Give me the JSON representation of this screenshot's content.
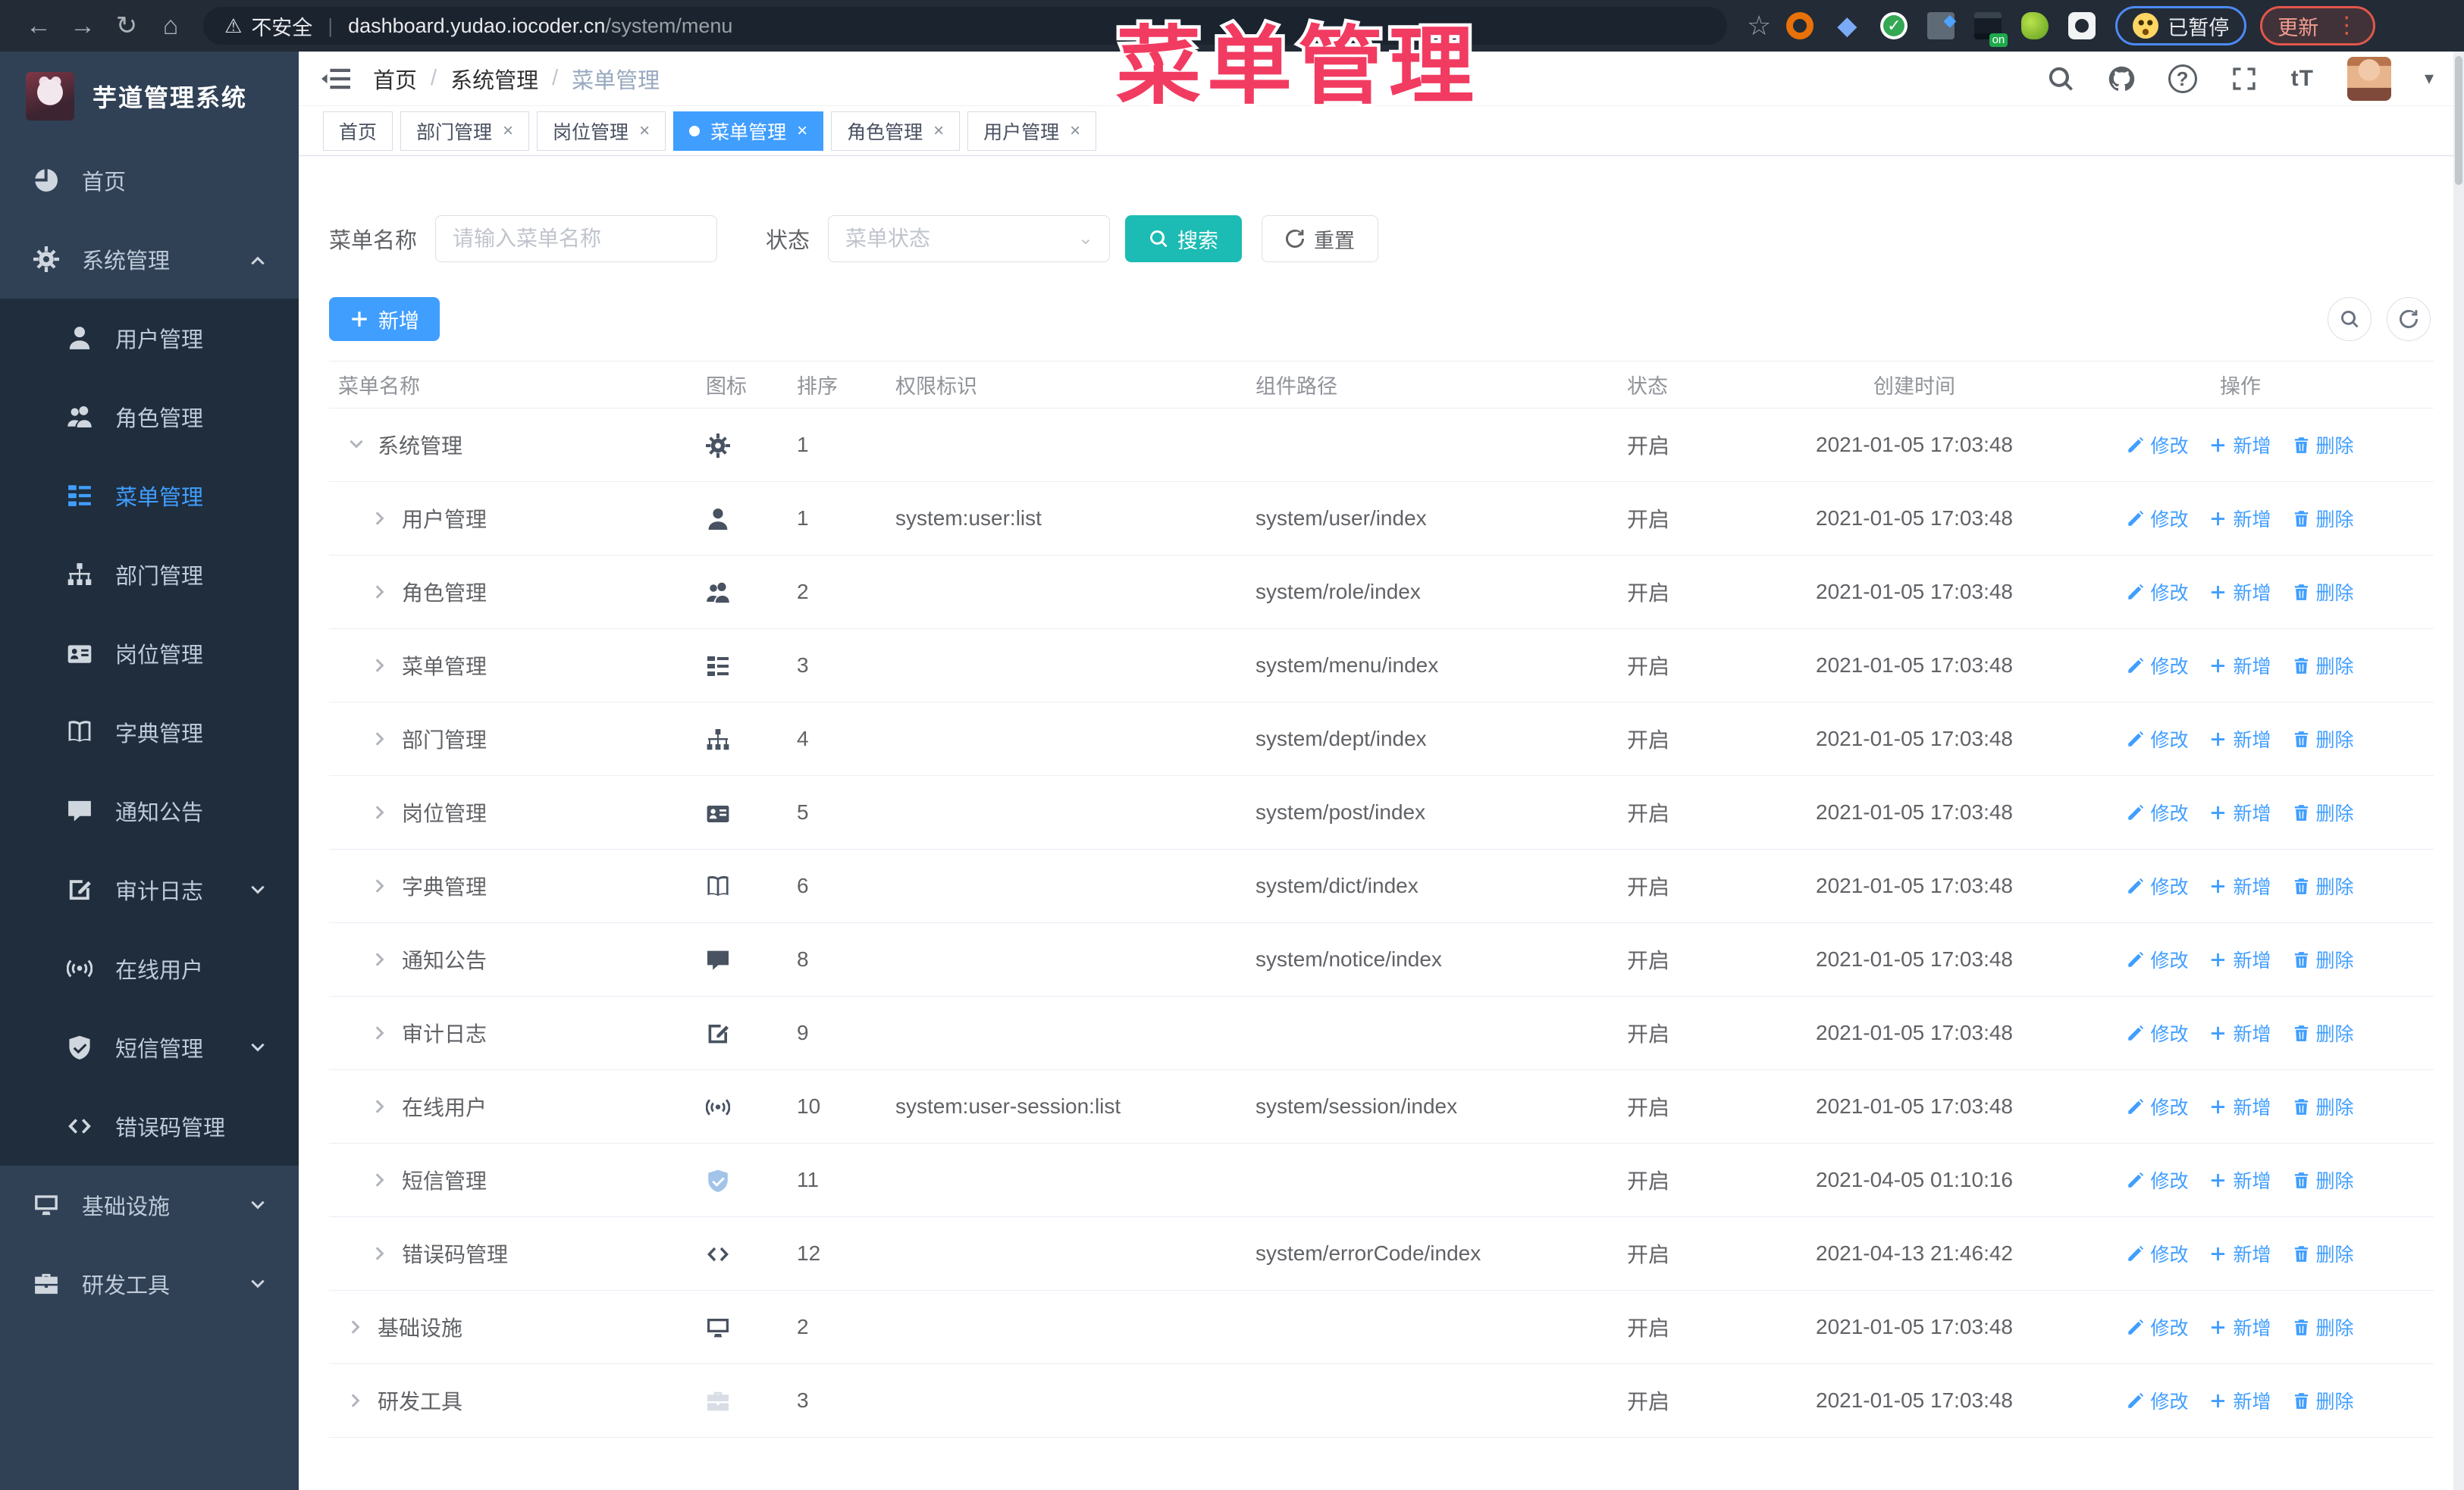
{
  "browser": {
    "security_label": "不安全",
    "url_domain": "dashboard.yudao.iocoder.cn",
    "url_path": "/system/menu",
    "paused_badge": "已暂停",
    "update_button": "更新",
    "toolbar_icons": [
      "back",
      "forward",
      "reload",
      "home",
      "warning",
      "star",
      "extensions",
      "profile",
      "menu-dots"
    ]
  },
  "overlay_title": "菜单管理",
  "sidebar": {
    "logo_title": "芋道管理系统",
    "items": [
      {
        "label": "首页",
        "icon": "dashboard",
        "type": "top",
        "chevron": ""
      },
      {
        "label": "系统管理",
        "icon": "gear",
        "type": "top",
        "chevron": "up"
      },
      {
        "label": "用户管理",
        "icon": "user",
        "type": "sub",
        "chevron": ""
      },
      {
        "label": "角色管理",
        "icon": "users",
        "type": "sub",
        "chevron": ""
      },
      {
        "label": "菜单管理",
        "icon": "tree-table",
        "type": "sub",
        "chevron": "",
        "active": true
      },
      {
        "label": "部门管理",
        "icon": "tree",
        "type": "sub",
        "chevron": ""
      },
      {
        "label": "岗位管理",
        "icon": "post",
        "type": "sub",
        "chevron": ""
      },
      {
        "label": "字典管理",
        "icon": "dict",
        "type": "sub",
        "chevron": ""
      },
      {
        "label": "通知公告",
        "icon": "message",
        "type": "sub",
        "chevron": ""
      },
      {
        "label": "审计日志",
        "icon": "log",
        "type": "sub",
        "chevron": "down"
      },
      {
        "label": "在线用户",
        "icon": "online",
        "type": "sub",
        "chevron": ""
      },
      {
        "label": "短信管理",
        "icon": "sms",
        "type": "sub",
        "chevron": "down"
      },
      {
        "label": "错误码管理",
        "icon": "code",
        "type": "sub",
        "chevron": ""
      },
      {
        "label": "基础设施",
        "icon": "monitor",
        "type": "top",
        "chevron": "down"
      },
      {
        "label": "研发工具",
        "icon": "tool",
        "type": "top",
        "chevron": "down"
      }
    ]
  },
  "breadcrumb": {
    "items": [
      "首页",
      "系统管理",
      "菜单管理"
    ]
  },
  "header_icons": [
    "search",
    "github",
    "help",
    "fullscreen",
    "font-size",
    "avatar",
    "caret-down"
  ],
  "tabs": [
    {
      "label": "首页",
      "closable": false,
      "active": false
    },
    {
      "label": "部门管理",
      "closable": true,
      "active": false
    },
    {
      "label": "岗位管理",
      "closable": true,
      "active": false
    },
    {
      "label": "菜单管理",
      "closable": true,
      "active": true
    },
    {
      "label": "角色管理",
      "closable": true,
      "active": false
    },
    {
      "label": "用户管理",
      "closable": true,
      "active": false
    }
  ],
  "filters": {
    "name_label": "菜单名称",
    "name_placeholder": "请输入菜单名称",
    "status_label": "状态",
    "status_placeholder": "菜单状态",
    "search_button": "搜索",
    "reset_button": "重置"
  },
  "toolbar": {
    "add_button": "新增"
  },
  "table": {
    "columns": [
      "菜单名称",
      "图标",
      "排序",
      "权限标识",
      "组件路径",
      "状态",
      "创建时间",
      "操作"
    ],
    "ops": [
      "修改",
      "新增",
      "删除"
    ],
    "rows": [
      {
        "level": 0,
        "arrow": "down",
        "name": "系统管理",
        "icon": "gear",
        "icon_tone": "",
        "sort": "1",
        "perms": "",
        "path": "",
        "status": "开启",
        "time": "2021-01-05 17:03:48"
      },
      {
        "level": 1,
        "arrow": "right",
        "name": "用户管理",
        "icon": "user",
        "icon_tone": "",
        "sort": "1",
        "perms": "system:user:list",
        "path": "system/user/index",
        "status": "开启",
        "time": "2021-01-05 17:03:48"
      },
      {
        "level": 1,
        "arrow": "right",
        "name": "角色管理",
        "icon": "users",
        "icon_tone": "",
        "sort": "2",
        "perms": "",
        "path": "system/role/index",
        "status": "开启",
        "time": "2021-01-05 17:03:48"
      },
      {
        "level": 1,
        "arrow": "right",
        "name": "菜单管理",
        "icon": "tree-table",
        "icon_tone": "",
        "sort": "3",
        "perms": "",
        "path": "system/menu/index",
        "status": "开启",
        "time": "2021-01-05 17:03:48"
      },
      {
        "level": 1,
        "arrow": "right",
        "name": "部门管理",
        "icon": "tree",
        "icon_tone": "",
        "sort": "4",
        "perms": "",
        "path": "system/dept/index",
        "status": "开启",
        "time": "2021-01-05 17:03:48"
      },
      {
        "level": 1,
        "arrow": "right",
        "name": "岗位管理",
        "icon": "post",
        "icon_tone": "",
        "sort": "5",
        "perms": "",
        "path": "system/post/index",
        "status": "开启",
        "time": "2021-01-05 17:03:48"
      },
      {
        "level": 1,
        "arrow": "right",
        "name": "字典管理",
        "icon": "dict",
        "icon_tone": "",
        "sort": "6",
        "perms": "",
        "path": "system/dict/index",
        "status": "开启",
        "time": "2021-01-05 17:03:48"
      },
      {
        "level": 1,
        "arrow": "right",
        "name": "通知公告",
        "icon": "message",
        "icon_tone": "",
        "sort": "8",
        "perms": "",
        "path": "system/notice/index",
        "status": "开启",
        "time": "2021-01-05 17:03:48"
      },
      {
        "level": 1,
        "arrow": "right",
        "name": "审计日志",
        "icon": "log",
        "icon_tone": "",
        "sort": "9",
        "perms": "",
        "path": "",
        "status": "开启",
        "time": "2021-01-05 17:03:48"
      },
      {
        "level": 1,
        "arrow": "right",
        "name": "在线用户",
        "icon": "online",
        "icon_tone": "",
        "sort": "10",
        "perms": "system:user-session:list",
        "path": "system/session/index",
        "status": "开启",
        "time": "2021-01-05 17:03:48"
      },
      {
        "level": 1,
        "arrow": "right",
        "name": "短信管理",
        "icon": "sms",
        "icon_tone": "light-blue",
        "sort": "11",
        "perms": "",
        "path": "",
        "status": "开启",
        "time": "2021-04-05 01:10:16"
      },
      {
        "level": 1,
        "arrow": "right",
        "name": "错误码管理",
        "icon": "code",
        "icon_tone": "",
        "sort": "12",
        "perms": "",
        "path": "system/errorCode/index",
        "status": "开启",
        "time": "2021-04-13 21:46:42"
      },
      {
        "level": 0,
        "arrow": "right",
        "name": "基础设施",
        "icon": "monitor",
        "icon_tone": "",
        "sort": "2",
        "perms": "",
        "path": "",
        "status": "开启",
        "time": "2021-01-05 17:03:48"
      },
      {
        "level": 0,
        "arrow": "right",
        "name": "研发工具",
        "icon": "tool",
        "icon_tone": "light-gray",
        "sort": "3",
        "perms": "",
        "path": "",
        "status": "开启",
        "time": "2021-01-05 17:03:48"
      }
    ]
  },
  "colors": {
    "primary": "#409eff",
    "search_button": "#1cbcb4",
    "sidebar_bg": "#304156",
    "submenu_bg": "#1f2d3d",
    "overlay_pink": "#f23b61",
    "chrome_bg": "#232b36"
  }
}
